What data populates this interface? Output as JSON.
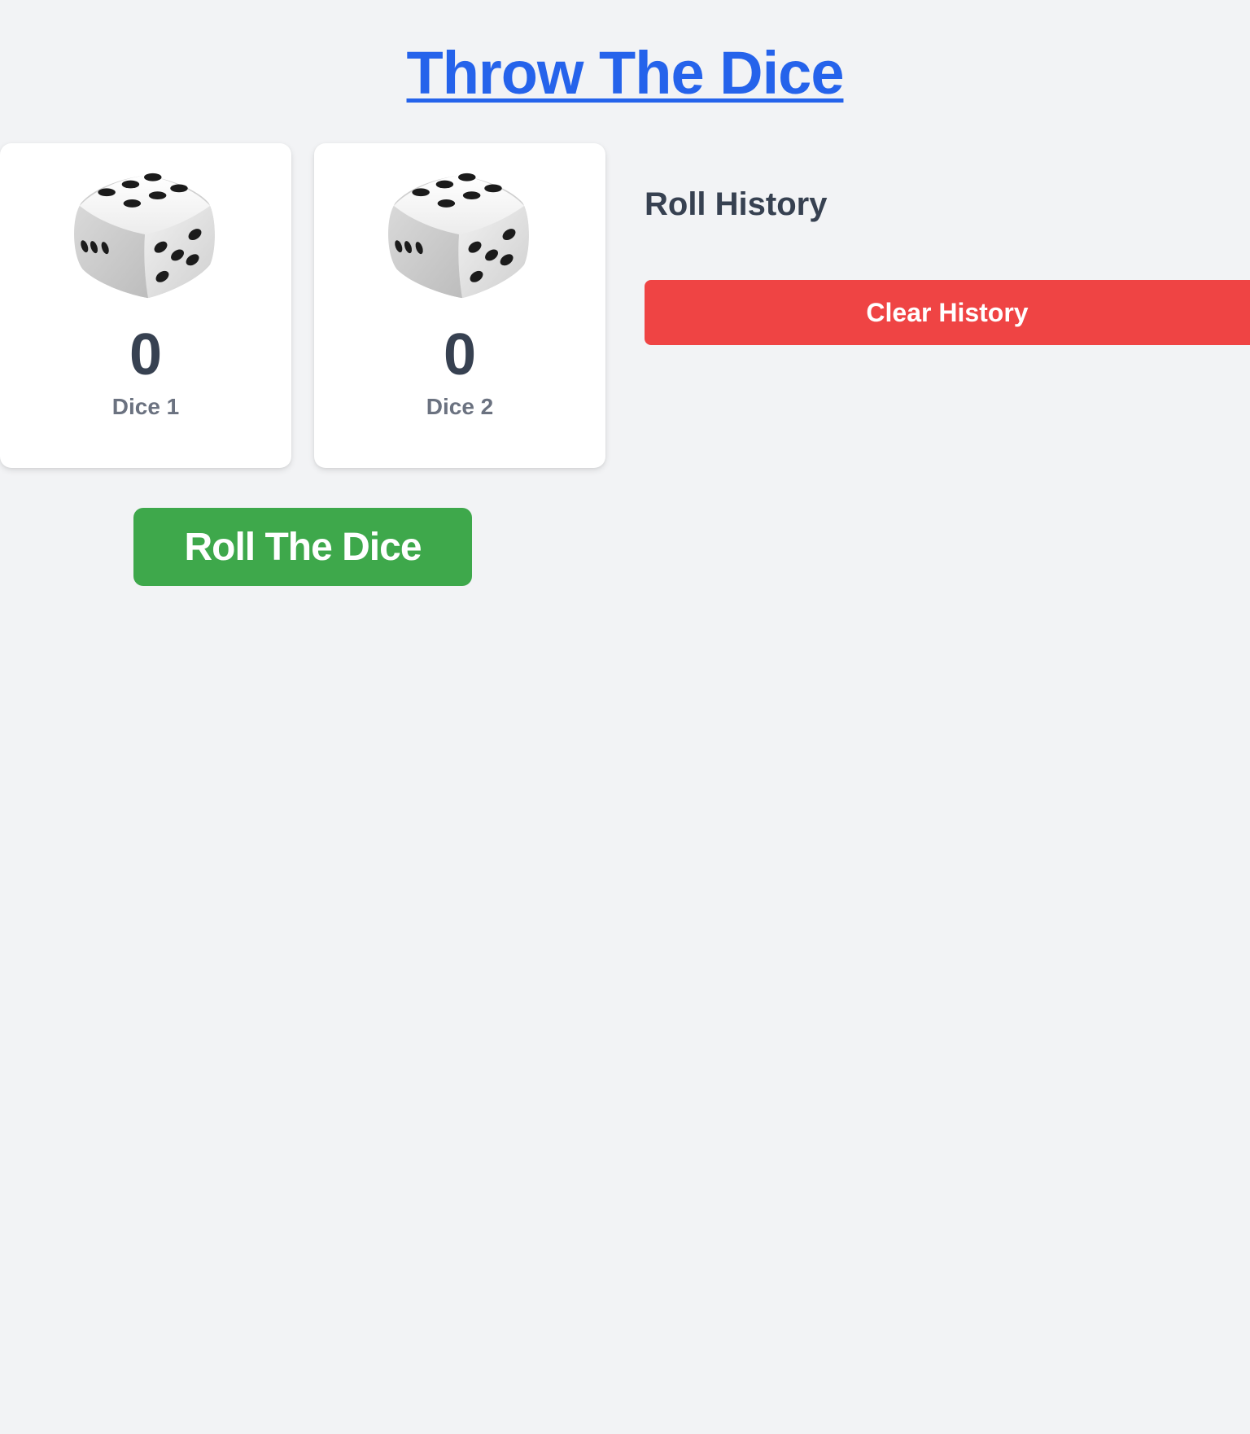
{
  "header": {
    "title": "Throw The Dice"
  },
  "dice": [
    {
      "value": "0",
      "label": "Dice 1",
      "icon": "die-icon"
    },
    {
      "value": "0",
      "label": "Dice 2",
      "icon": "die-icon"
    }
  ],
  "controls": {
    "roll_label": "Roll The Dice"
  },
  "history": {
    "heading": "Roll History",
    "clear_label": "Clear History",
    "entries": []
  },
  "colors": {
    "background": "#f2f3f5",
    "title": "#2563eb",
    "roll_button": "#3ea84b",
    "clear_button": "#ef4444",
    "text_dark": "#374151",
    "text_muted": "#6b7280"
  }
}
